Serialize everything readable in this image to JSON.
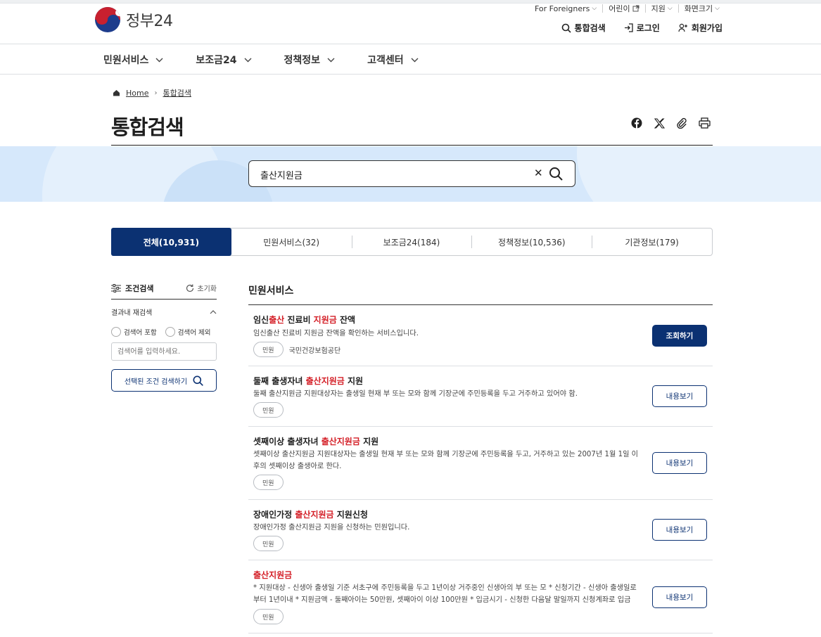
{
  "header": {
    "logo_text": "정부24",
    "util": [
      "For Foreigners",
      "어린이",
      "지원",
      "화면크기"
    ],
    "account": [
      "통합검색",
      "로그인",
      "회원가입"
    ]
  },
  "gnb": [
    "민원서비스",
    "보조금24",
    "정책정보",
    "고객센터"
  ],
  "breadcrumb": [
    "Home",
    "통합검색"
  ],
  "page_title": "통합검색",
  "search": {
    "value": "출산지원금"
  },
  "tabs": [
    {
      "label": "전체(10,931)",
      "active": true
    },
    {
      "label": "민원서비스(32)"
    },
    {
      "label": "보조금24(184)"
    },
    {
      "label": "정책정보(10,536)"
    },
    {
      "label": "기관정보(179)"
    }
  ],
  "filter": {
    "title": "조건검색",
    "reset": "초기화",
    "sub_title": "결과내 재검색",
    "radio_include": "검색어 포함",
    "radio_exclude": "검색어 제외",
    "input_placeholder": "검색어를 입력하세요.",
    "search_button": "선택된 조건 검색하기"
  },
  "results": {
    "section_title": "민원서비스",
    "items": [
      {
        "title_parts": [
          "임신",
          "출산",
          " 진료비 ",
          "지원금",
          " 잔액"
        ],
        "desc": "임신출산 진료비 지원금 잔액을 확인하는 서비스입니다.",
        "tag": "민원",
        "org": "국민건강보험공단",
        "button": "조회하기"
      },
      {
        "title_parts": [
          "둘째 출생자녀 ",
          "출산지원금",
          " 지원"
        ],
        "desc": "둘째 출산지원금 지원대상자는 출생일 현재 부 또는 모와 함께 기장군에 주민등록을 두고 거주하고 있어야 함.",
        "tag": "민원",
        "button": "내용보기"
      },
      {
        "title_parts": [
          "셋째이상 출생자녀 ",
          "출산지원금",
          " 지원"
        ],
        "desc": "셋째이상 출산지원금 지원대상자는 출생일 현재 부 또는 모와 함께 기장군에 주민등록을 두고, 거주하고 있는 2007년 1월 1일 이후의 셋째이상 출생아로 한다.",
        "tag": "민원",
        "button": "내용보기"
      },
      {
        "title_parts": [
          "장애인가정 ",
          "출산지원금",
          " 지원신청"
        ],
        "desc": "장애인가정 출산지원금 지원을 신청하는 민원입니다.",
        "tag": "민원",
        "button": "내용보기"
      },
      {
        "title_parts": [
          "",
          "출산지원금",
          ""
        ],
        "desc": "* 지원대상 - 신생아 출생일 기준 서초구에 주민등록을 두고 1년이상 거주중인 신생아의 부 또는 모 * 신청기간 - 신생아 출생일로부터 1년이내 * 지원금액 - 둘째아이는 50만원, 셋째아이 이상 100만원 * 입금시기 - 신청한 다음달 말일까지 신청계좌로 입금",
        "tag": "민원",
        "button": "내용보기"
      }
    ]
  }
}
